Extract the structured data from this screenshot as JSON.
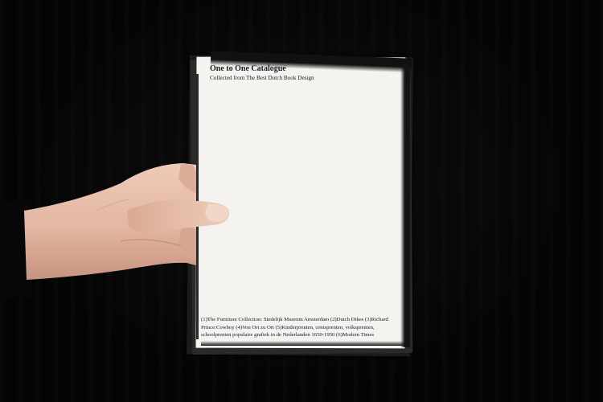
{
  "catalogue": {
    "title": "One to One Catalogue",
    "subtitle": "Collected from The Best Dutch Book Design",
    "caption": "(1)The Furniture Collection: Stedelijk Museum Amsterdam (2)Dutch Dikes (3)Richard Prince:Cowboy (4)Von Ort zu Ort (5)Kinderprenten, centsprenten, volksprenten, schoolprenten populaire grafiek in de Nederlanden 1650-1950 (6)Modern Times"
  },
  "colors": {
    "background": "#050505",
    "paper": "#f4f3f0",
    "ink": "#1a1a1a",
    "skin": "#e3b9a6"
  }
}
